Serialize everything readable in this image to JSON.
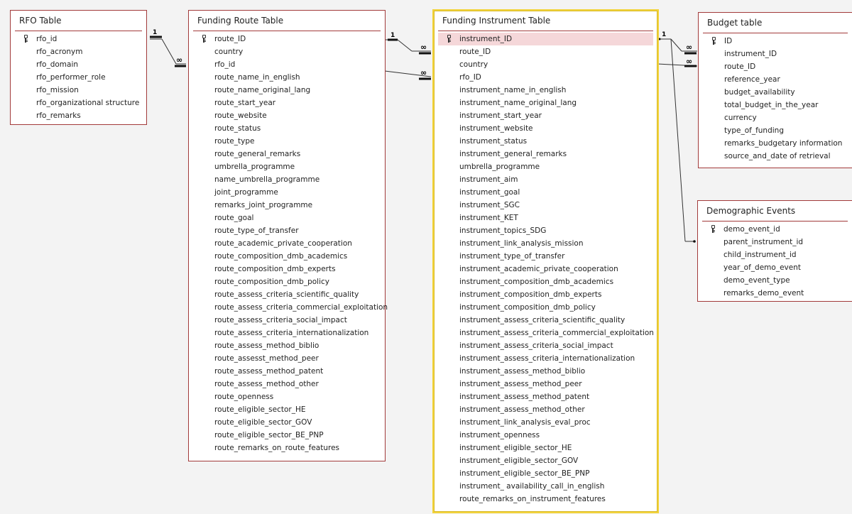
{
  "tables": {
    "rfo": {
      "title": "RFO Table",
      "fields": [
        "rfo_id",
        "rfo_acronym",
        "rfo_domain",
        "rfo_performer_role",
        "rfo_mission",
        "rfo_organizational structure",
        "rfo_remarks"
      ]
    },
    "route": {
      "title": "Funding Route Table",
      "fields": [
        "route_ID",
        "country",
        "rfo_id",
        "route_name_in_english",
        "route_name_original_lang",
        "route_start_year",
        "route_website",
        "route_status",
        "route_type",
        "route_general_remarks",
        "umbrella_programme",
        "name_umbrella_programme",
        "joint_programme",
        "remarks_joint_programme",
        "route_goal",
        "route_type_of_transfer",
        "route_academic_private_cooperation",
        "route_composition_dmb_academics",
        "route_composition_dmb_experts",
        "route_composition_dmb_policy",
        "route_assess_criteria_scientific_quality",
        "route_assess_criteria_commercial_exploitation",
        "route_assess_criteria_social_impact",
        "route_assess_criteria_internationalization",
        "route_assess_method_biblio",
        "route_assesst_method_peer",
        "route_assess_method_patent",
        "route_assess_method_other",
        "route_openness",
        "route_eligible_sector_HE",
        "route_eligible_sector_GOV",
        "route_eligible_sector_BE_PNP",
        "route_remarks_on_route_features"
      ]
    },
    "instrument": {
      "title": "Funding Instrument Table",
      "fields": [
        "instrument_ID",
        "route_ID",
        "country",
        "rfo_ID",
        "instrument_name_in_english",
        "instrument_name_original_lang",
        "instrument_start_year",
        "instrument_website",
        "instrument_status",
        "instrument_general_remarks",
        "umbrella_programme",
        "instrument_aim",
        "instrument_goal",
        "instrument_SGC",
        "instrument_KET",
        "instrument_topics_SDG",
        "instrument_link_analysis_mission",
        "instrument_type_of_transfer",
        "instrument_academic_private_cooperation",
        "instrument_composition_dmb_academics",
        "instrument_composition_dmb_experts",
        "instrument_composition_dmb_policy",
        "instrument_assess_criteria_scientific_quality",
        "instrument_assess_criteria_commercial_exploitation",
        "instrument_assess_criteria_social_impact",
        "instrument_assess_criteria_internationalization",
        "instrument_assess_method_biblio",
        "instrument_assess_method_peer",
        "instrument_assess_method_patent",
        "instrument_assess_method_other",
        "instrument_link_analysis_eval_proc",
        "instrument_openness",
        "instrument_eligible_sector_HE",
        "instrument_eligible_sector_GOV",
        "instrument_eligible_sector_BE_PNP",
        "instrument_ availability_call_in_english",
        "route_remarks_on_instrument_features"
      ]
    },
    "budget": {
      "title": "Budget table",
      "fields": [
        "ID",
        "instrument_ID",
        "route_ID",
        "reference_year",
        "budget_availability",
        "total_budget_in_the_year",
        "currency",
        "type_of_funding",
        "remarks_budgetary information",
        "source_and_date of retrieval"
      ]
    },
    "demo": {
      "title": "Demographic Events",
      "fields": [
        "demo_event_id",
        "parent_instrument_id",
        "child_instrument_id",
        "year_of_demo_event",
        "demo_event_type",
        "remarks_demo_event"
      ]
    }
  },
  "relationships": {
    "one_label": "1",
    "many_label": "∞"
  },
  "icons": {
    "primary_key": "key-icon"
  }
}
